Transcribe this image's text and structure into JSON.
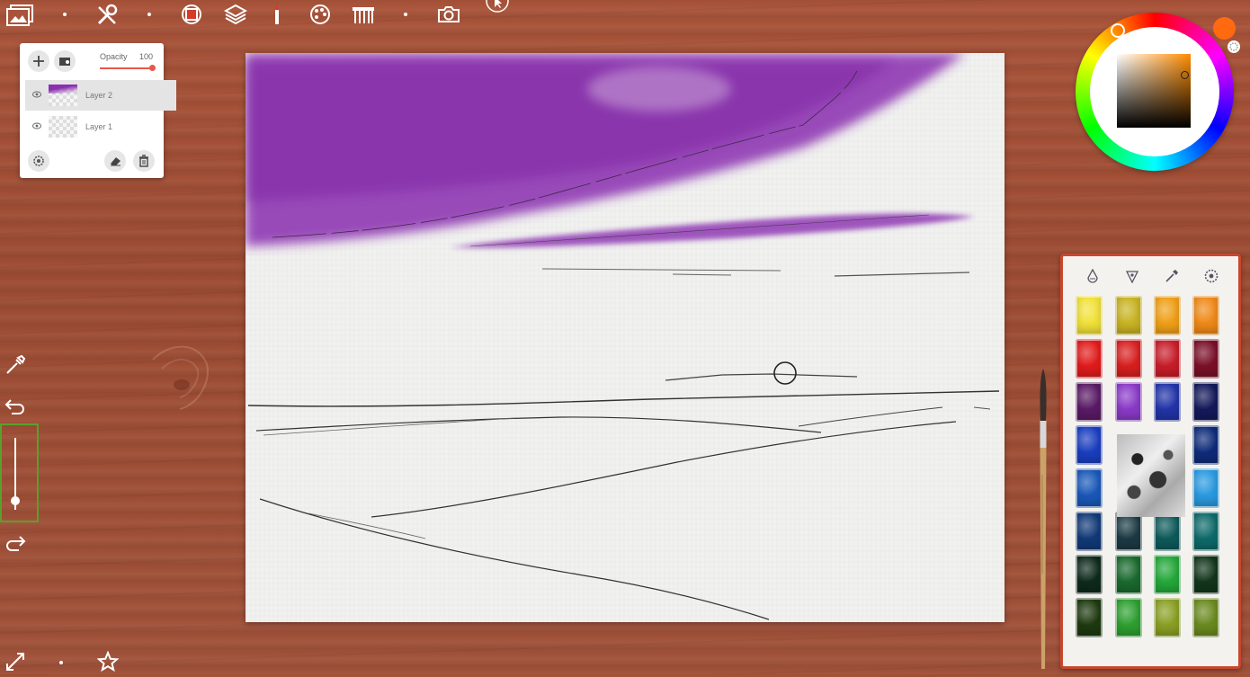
{
  "toolbar": {
    "icons": [
      "gallery-icon",
      "tools-icon",
      "brush-size-icon",
      "layers-icon",
      "brush-icon",
      "palette-icon",
      "paper-icon",
      "camera-icon"
    ]
  },
  "layers_panel": {
    "opacity_label": "Opacity",
    "opacity_value": "100",
    "opacity_level_percent": 100,
    "layers": [
      {
        "name": "Layer 2",
        "selected": true
      },
      {
        "name": "Layer 1",
        "selected": false
      }
    ]
  },
  "colors": {
    "current_color": "#ff6a10",
    "accent_border": "#c8472f",
    "slider_highlight": "#5aa02c",
    "paint_wash": "#8a2fb0"
  },
  "paints": [
    [
      "#f2e23a",
      "#c9b423",
      "#f0a018",
      "#f08a18"
    ],
    [
      "#e21b1b",
      "#d81f1f",
      "#c71d2a",
      "#7a1028"
    ],
    [
      "#5a1a66",
      "#8a3ac8",
      "#2234a8",
      "#141a5a"
    ],
    [
      "#1a3ec0",
      "#1c2e8a",
      "#1c2a70",
      "#0f2c7a"
    ],
    [
      "#1a58b8",
      "#2a3040",
      "#1c2a3a",
      "#2a9ae0"
    ],
    [
      "#123a78",
      "#1c3a44",
      "#0e5a5a",
      "#0f6a6a"
    ],
    [
      "#0e2a1c",
      "#1a6a2e",
      "#24a83a",
      "#13361c"
    ],
    [
      "#1e3a10",
      "#2ea030",
      "#8aa024",
      "#6a8a20"
    ]
  ],
  "brush_size_slider": {
    "level_percent": 76
  }
}
